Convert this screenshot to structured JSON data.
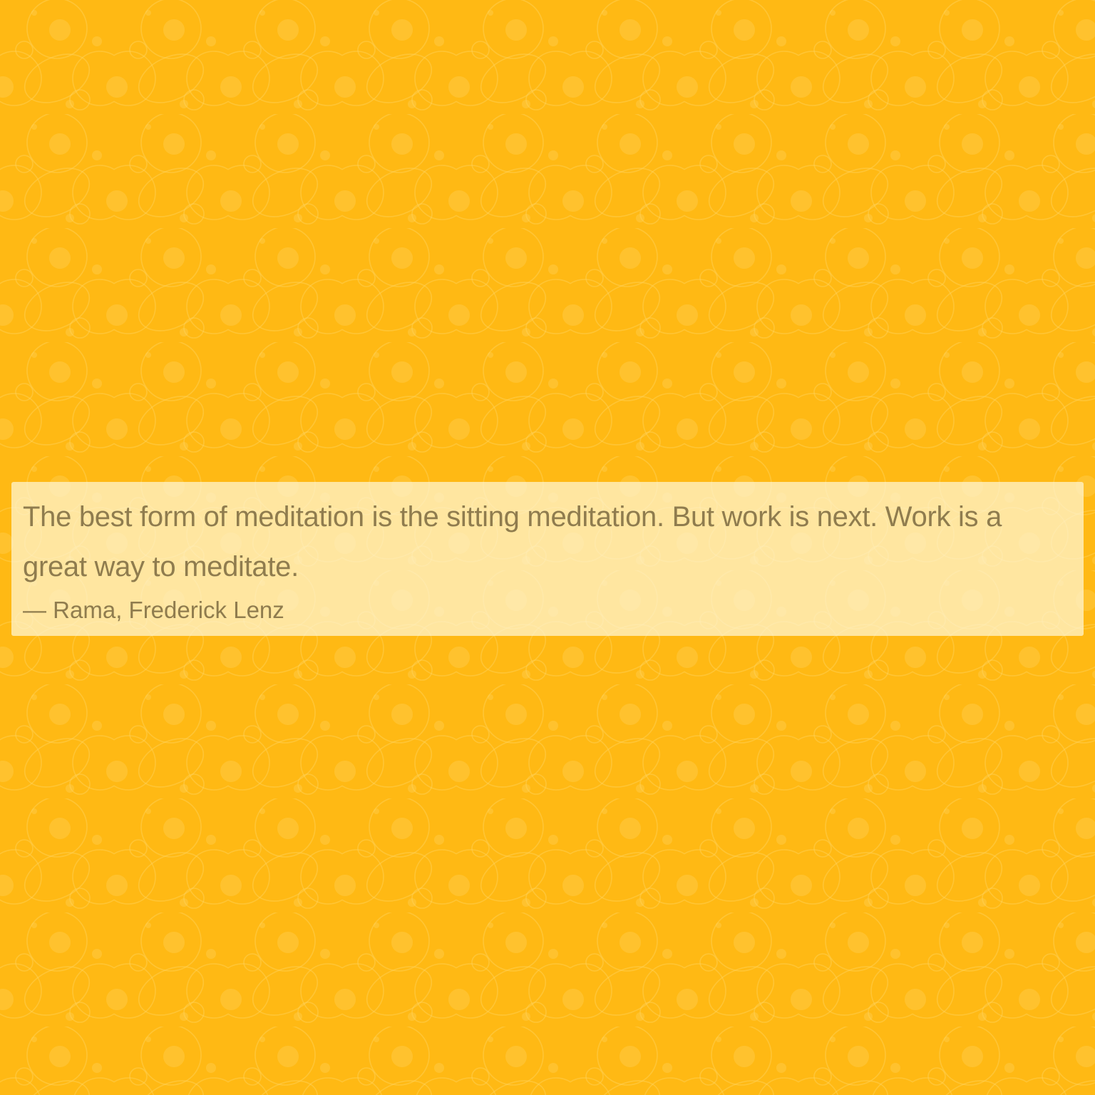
{
  "colors": {
    "background": "#ffb914",
    "quote_panel": "#fff6d7",
    "text": "#8f7c4e"
  },
  "quote": {
    "text": "The best form of meditation is the sitting meditation. But work is next. Work is a great way to meditate.",
    "attribution": "— Rama, Frederick Lenz"
  }
}
